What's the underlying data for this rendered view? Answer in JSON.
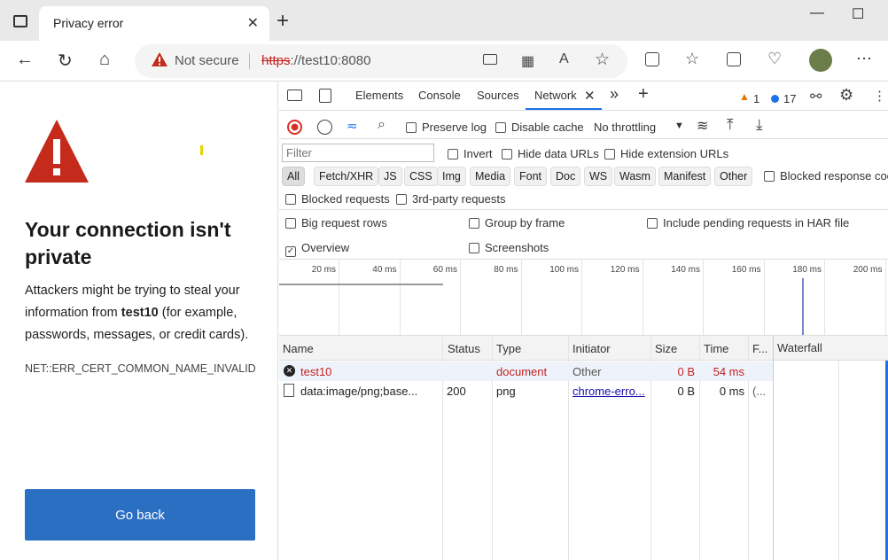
{
  "tab": {
    "title": "Privacy error",
    "close": "✕",
    "new_tab": "+"
  },
  "window": {
    "minimize": "—",
    "maximize": "☐"
  },
  "address": {
    "not_secure": "Not secure",
    "scheme": "https",
    "rest": "://test10:8080"
  },
  "page": {
    "heading": "Your connection isn't private",
    "desc_before": "Attackers might be trying to steal your information from ",
    "desc_host": "test10",
    "desc_after": " (for example, passwords, messages, or credit cards).",
    "error_code": "NET::ERR_CERT_COMMON_NAME_INVALID",
    "go_back": "Go back"
  },
  "devtools": {
    "tabs": [
      "Elements",
      "Console",
      "Sources",
      "Network"
    ],
    "more": "»",
    "add": "+",
    "warnings": "1",
    "issues": "17",
    "toolbar": {
      "preserve_log": "Preserve log",
      "disable_cache": "Disable cache",
      "throttling": "No throttling"
    },
    "filter_placeholder": "Filter",
    "invert": "Invert",
    "hide_data_urls": "Hide data URLs",
    "hide_ext_urls": "Hide extension URLs",
    "types": [
      "All",
      "Fetch/XHR",
      "JS",
      "CSS",
      "Img",
      "Media",
      "Font",
      "Doc",
      "WS",
      "Wasm",
      "Manifest",
      "Other"
    ],
    "blocked_response": "Blocked response coo",
    "blocked_requests": "Blocked requests",
    "third_party": "3rd-party requests",
    "big_rows": "Big request rows",
    "group_frame": "Group by frame",
    "include_pending": "Include pending requests in HAR file",
    "overview": "Overview",
    "screenshots": "Screenshots",
    "ticks": [
      "20 ms",
      "40 ms",
      "60 ms",
      "80 ms",
      "100 ms",
      "120 ms",
      "140 ms",
      "160 ms",
      "180 ms",
      "200 ms"
    ],
    "columns": [
      "Name",
      "Status",
      "Type",
      "Initiator",
      "Size",
      "Time",
      "F...",
      "Waterfall"
    ],
    "rows": [
      {
        "name": "test10",
        "status": "",
        "type": "document",
        "initiator": "Other",
        "size": "0 B",
        "time": "54 ms",
        "f": ""
      },
      {
        "name": "data:image/png;base...",
        "status": "200",
        "type": "png",
        "initiator": "chrome-erro...",
        "size": "0 B",
        "time": "0 ms",
        "f": "(..."
      }
    ]
  },
  "colors": {
    "accent": "#1a73e8",
    "error": "#c5221f",
    "button": "#2b6fc3",
    "warning_red": "#c42b1c"
  }
}
